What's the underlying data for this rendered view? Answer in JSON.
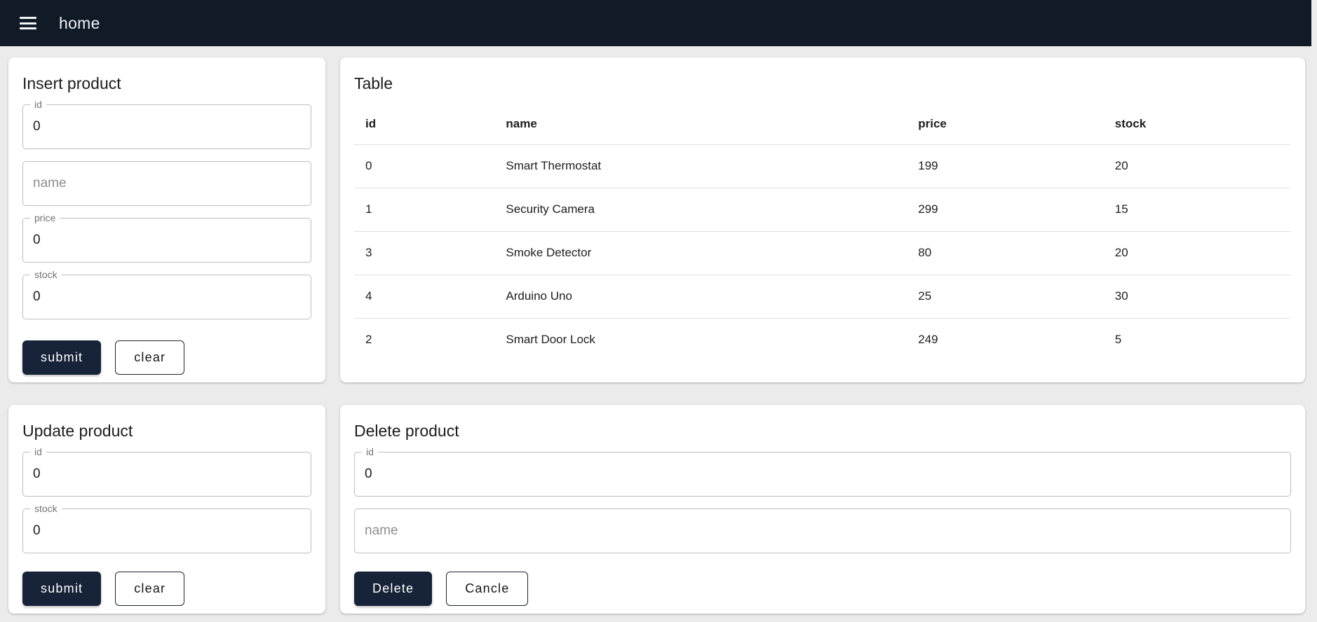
{
  "appbar": {
    "title": "home"
  },
  "colors": {
    "appbar_bg": "#111b28",
    "button_bg": "#162338",
    "page_bg": "#ebebeb",
    "field_border": "#bdbdbd",
    "divider": "#e0e0e0"
  },
  "insert_card": {
    "title": "Insert product",
    "id_field": {
      "label": "id",
      "value": "0"
    },
    "name_field": {
      "placeholder": "name"
    },
    "price_field": {
      "label": "price",
      "value": "0"
    },
    "stock_field": {
      "label": "stock",
      "value": "0"
    },
    "submit_label": "submit",
    "clear_label": "clear"
  },
  "table_card": {
    "title": "Table",
    "columns": {
      "id": "id",
      "name": "name",
      "price": "price",
      "stock": "stock"
    },
    "rows": [
      [
        "0",
        "Smart Thermostat",
        "199",
        "20"
      ],
      [
        "1",
        "Security Camera",
        "299",
        "15"
      ],
      [
        "3",
        "Smoke Detector",
        "80",
        "20"
      ],
      [
        "4",
        "Arduino Uno",
        "25",
        "30"
      ],
      [
        "2",
        "Smart Door Lock",
        "249",
        "5"
      ]
    ]
  },
  "update_card": {
    "title": "Update product",
    "id_field": {
      "label": "id",
      "value": "0"
    },
    "stock_field": {
      "label": "stock",
      "value": "0"
    },
    "submit_label": "submit",
    "clear_label": "clear"
  },
  "delete_card": {
    "title": "Delete product",
    "id_field": {
      "label": "id",
      "value": "0"
    },
    "name_field": {
      "placeholder": "name"
    },
    "delete_label": "Delete",
    "cancel_label": "Cancle"
  }
}
